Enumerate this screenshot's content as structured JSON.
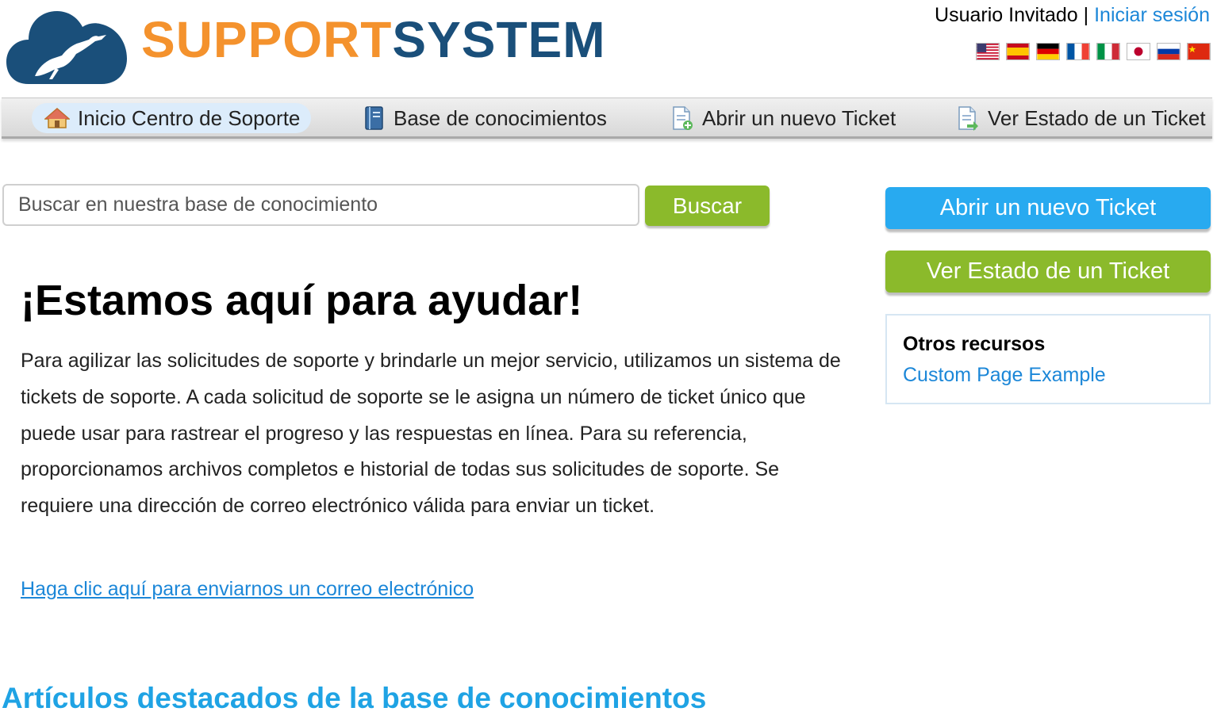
{
  "logo": {
    "text_primary": "SUPPORT",
    "text_secondary": "SYSTEM"
  },
  "userbar": {
    "user": "Usuario Invitado",
    "separator": " | ",
    "login_link": "Iniciar sesión"
  },
  "flags": [
    "us-flag",
    "es-flag",
    "de-flag",
    "fr-flag",
    "it-flag",
    "jp-flag",
    "ru-flag",
    "cn-flag"
  ],
  "nav": {
    "items": [
      {
        "label": "Inicio Centro de Soporte",
        "icon": "home-icon",
        "active": true
      },
      {
        "label": "Base de conocimientos",
        "icon": "book-icon",
        "active": false
      },
      {
        "label": "Abrir un nuevo Ticket",
        "icon": "new-ticket-icon",
        "active": false
      },
      {
        "label": "Ver Estado de un Ticket",
        "icon": "ticket-status-icon",
        "active": false
      }
    ]
  },
  "search": {
    "placeholder": "Buscar en nuestra base de conocimiento",
    "button": "Buscar"
  },
  "main": {
    "title": "¡Estamos aquí para ayudar!",
    "intro": "Para agilizar las solicitudes de soporte y brindarle un mejor servicio, utilizamos un sistema de tickets de soporte. A cada solicitud de soporte se le asigna un número de ticket único que puede usar para rastrear el progreso y las respuestas en línea. Para su referencia, proporcionamos archivos completos e historial de todas sus solicitudes de soporte. Se requiere una dirección de correo electrónico válida para enviar un ticket.",
    "email_link": "Haga clic aquí para enviarnos un correo electrónico",
    "featured_title": "Artículos destacados de la base de conocimientos"
  },
  "sidebar": {
    "open_ticket": "Abrir un nuevo Ticket",
    "check_status": "Ver Estado de un Ticket",
    "resources_title": "Otros recursos",
    "resources_link": "Custom Page Example"
  },
  "colors": {
    "brand_orange": "#f4922d",
    "brand_blue": "#1a4f7a",
    "link": "#1c87d8",
    "green_button": "#8bba2b",
    "blue_button": "#28aaf0"
  }
}
